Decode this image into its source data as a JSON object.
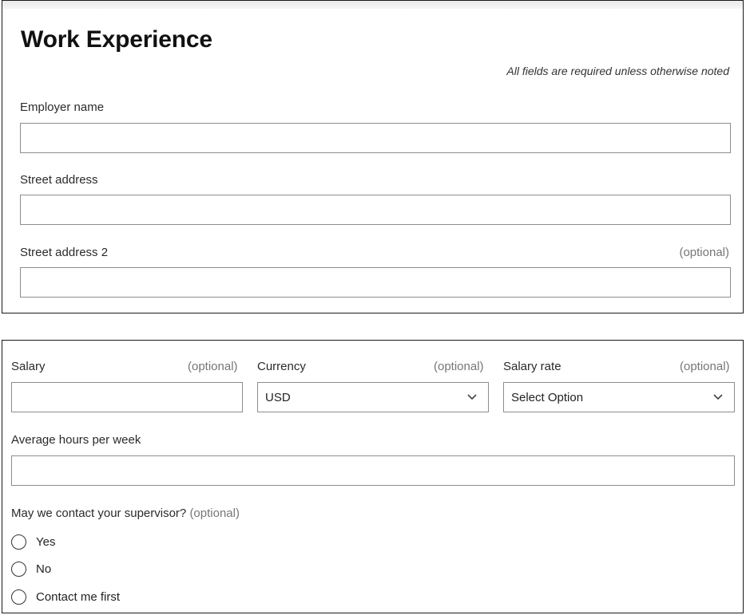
{
  "form": {
    "title": "Work Experience",
    "required_note": "All fields are required unless otherwise noted",
    "optional_text": "(optional)",
    "employer_name": {
      "label": "Employer name",
      "value": ""
    },
    "street_address": {
      "label": "Street address",
      "value": ""
    },
    "street_address_2": {
      "label": "Street address 2",
      "value": ""
    },
    "salary": {
      "label": "Salary",
      "value": ""
    },
    "currency": {
      "label": "Currency",
      "selected": "USD"
    },
    "salary_rate": {
      "label": "Salary rate",
      "selected": "Select Option"
    },
    "avg_hours": {
      "label": "Average hours per week",
      "value": ""
    },
    "supervisor": {
      "question": "May we contact your supervisor?",
      "options": [
        "Yes",
        "No",
        "Contact me first"
      ]
    }
  },
  "icons": {
    "select_arrow": "chevron-down-icon",
    "radio": "radio-unchecked"
  },
  "colors": {
    "border": "#8d8d8d",
    "text": "#222222",
    "muted": "#767676"
  }
}
